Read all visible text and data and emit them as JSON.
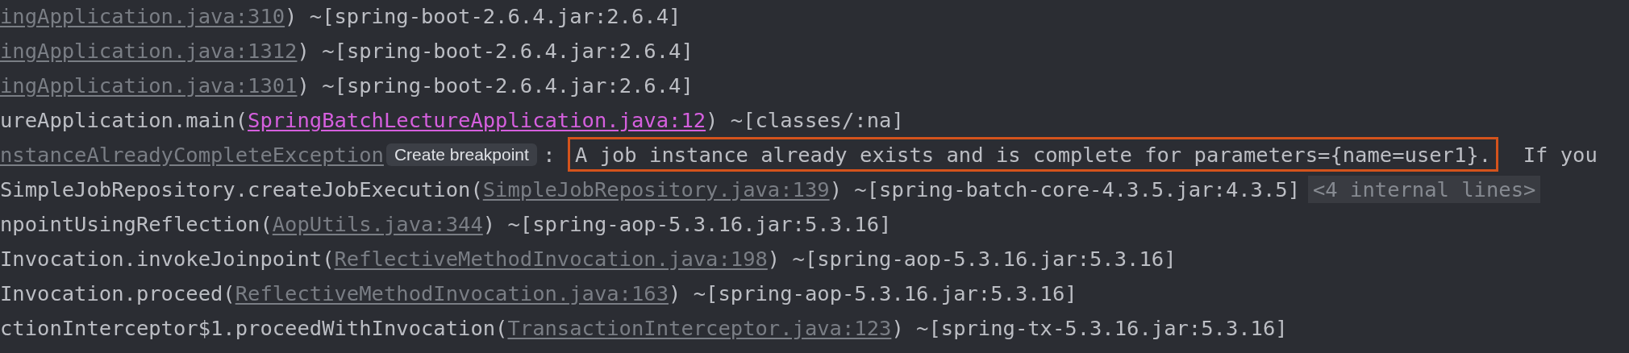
{
  "console_lines": [
    {
      "segments": [
        {
          "kind": "link",
          "text": "ingApplication.java:310"
        },
        {
          "kind": "text",
          "text": ") ~[spring-boot-2.6.4.jar:2.6.4]"
        }
      ]
    },
    {
      "segments": [
        {
          "kind": "link",
          "text": "ingApplication.java:1312"
        },
        {
          "kind": "text",
          "text": ") ~[spring-boot-2.6.4.jar:2.6.4]"
        }
      ]
    },
    {
      "segments": [
        {
          "kind": "link",
          "text": "ingApplication.java:1301"
        },
        {
          "kind": "text",
          "text": ") ~[spring-boot-2.6.4.jar:2.6.4]"
        }
      ]
    },
    {
      "segments": [
        {
          "kind": "text",
          "text": "ureApplication.main("
        },
        {
          "kind": "accent_link",
          "text": "SpringBatchLectureApplication.java:12"
        },
        {
          "kind": "text",
          "text": ") ~[classes/:na]"
        }
      ]
    },
    {
      "segments": [
        {
          "kind": "link",
          "text": "nstanceAlreadyCompleteException"
        },
        {
          "kind": "hint",
          "text": "Create breakpoint"
        },
        {
          "kind": "text",
          "text": " : "
        },
        {
          "kind": "highlight",
          "text": "A job instance already exists and is complete for parameters={name=user1}."
        },
        {
          "kind": "text",
          "text": "  If you"
        }
      ]
    },
    {
      "segments": [
        {
          "kind": "text",
          "text": "SimpleJobRepository.createJobExecution("
        },
        {
          "kind": "link",
          "text": "SimpleJobRepository.java:139"
        },
        {
          "kind": "text",
          "text": ") ~[spring-batch-core-4.3.5.jar:4.3.5]"
        },
        {
          "kind": "fold",
          "text": "<4 internal lines>"
        }
      ]
    },
    {
      "segments": [
        {
          "kind": "text",
          "text": "npointUsingReflection("
        },
        {
          "kind": "link",
          "text": "AopUtils.java:344"
        },
        {
          "kind": "text",
          "text": ") ~[spring-aop-5.3.16.jar:5.3.16]"
        }
      ]
    },
    {
      "segments": [
        {
          "kind": "text",
          "text": "Invocation.invokeJoinpoint("
        },
        {
          "kind": "link",
          "text": "ReflectiveMethodInvocation.java:198"
        },
        {
          "kind": "text",
          "text": ") ~[spring-aop-5.3.16.jar:5.3.16]"
        }
      ]
    },
    {
      "segments": [
        {
          "kind": "text",
          "text": "Invocation.proceed("
        },
        {
          "kind": "link",
          "text": "ReflectiveMethodInvocation.java:163"
        },
        {
          "kind": "text",
          "text": ") ~[spring-aop-5.3.16.jar:5.3.16]"
        }
      ]
    },
    {
      "segments": [
        {
          "kind": "text",
          "text": "ctionInterceptor$1.proceedWithInvocation("
        },
        {
          "kind": "link",
          "text": "TransactionInterceptor.java:123"
        },
        {
          "kind": "text",
          "text": ") ~[spring-tx-5.3.16.jar:5.3.16]"
        }
      ]
    }
  ]
}
